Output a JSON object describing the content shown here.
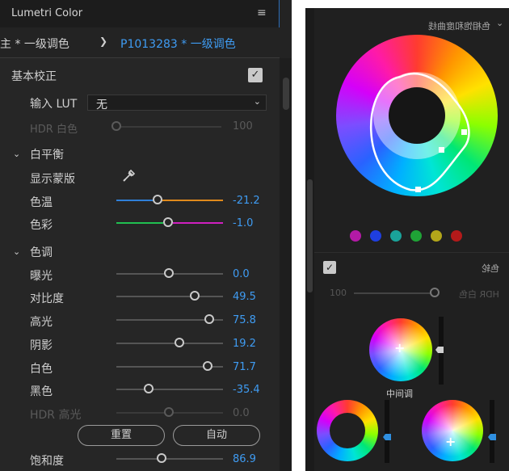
{
  "panel": {
    "title": "Lumetri Color",
    "menu_icon": "hamburger-menu-icon",
    "master_clip_tab": "主 * 一级调色",
    "clip_tab": "P1013283 * 一级调色"
  },
  "basic_correction": {
    "section_title": "基本校正",
    "enabled": true,
    "input_lut_label": "输入 LUT",
    "input_lut_value": "无",
    "hdr_white_label": "HDR 白色",
    "hdr_white_value": "100"
  },
  "white_balance": {
    "section_title": "白平衡",
    "show_mask_label": "显示蒙版",
    "eyedropper_icon": "eyedropper-icon",
    "temperature_label": "色温",
    "temperature_value": "-21.2",
    "tint_label": "色彩",
    "tint_value": "-1.0"
  },
  "tone": {
    "section_title": "色调",
    "exposure": {
      "label": "曝光",
      "value": "0.0"
    },
    "contrast": {
      "label": "对比度",
      "value": "49.5"
    },
    "highlights": {
      "label": "高光",
      "value": "75.8"
    },
    "shadows": {
      "label": "阴影",
      "value": "19.2"
    },
    "whites": {
      "label": "白色",
      "value": "71.7"
    },
    "blacks": {
      "label": "黑色",
      "value": "-35.4"
    },
    "hdr_specular": {
      "label": "HDR 高光",
      "value": "0.0"
    },
    "reset_button": "重置",
    "auto_button": "自动",
    "saturation": {
      "label": "饱和度",
      "value": "86.9"
    }
  },
  "right_panel": {
    "hue_sat_title": "色相饱和度曲线",
    "swatch_colors": [
      "#b31aa6",
      "#1f3fe0",
      "#1aa39a",
      "#1fa336",
      "#b3a61a",
      "#b31a1a"
    ],
    "color_wheels_title": "色轮",
    "hdr_white_label": "HDR 白色",
    "hdr_white_value": "100",
    "midtones_label": "中间调"
  }
}
